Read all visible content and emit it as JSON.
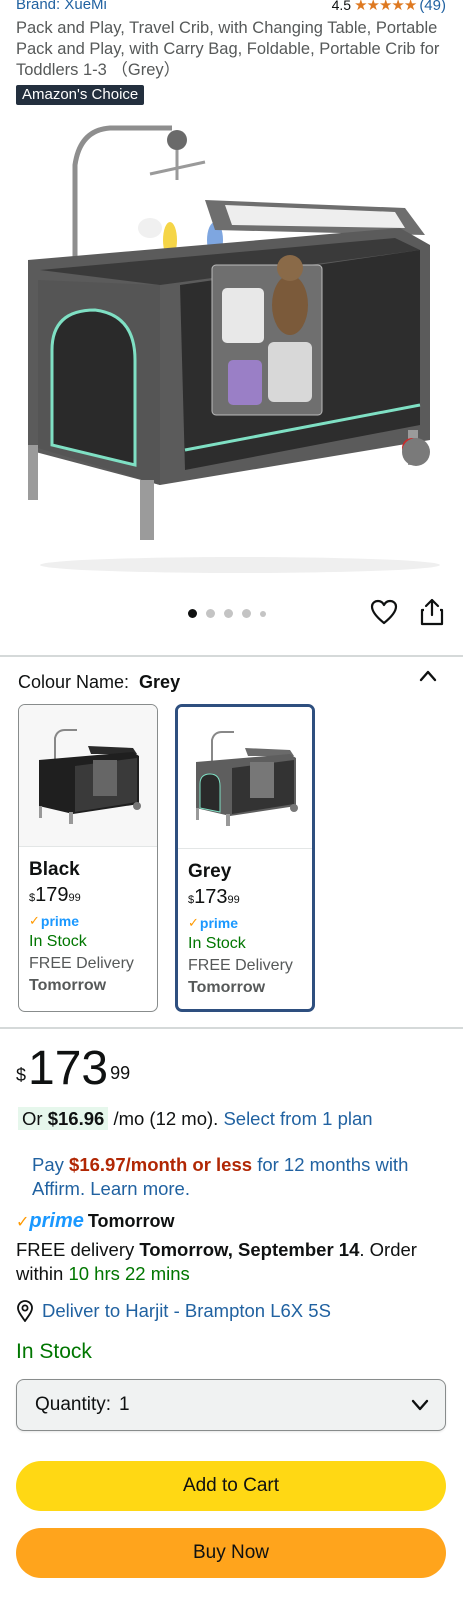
{
  "brand": "Brand: XueMi",
  "rating": {
    "value": "4.5",
    "stars": "★★★★★",
    "count": "(49)"
  },
  "title": "Pack and Play, Travel Crib, with Changing Table, Portable Pack and Play, with Carry Bag, Foldable, Portable Crib for Toddlers 1-3 （Grey）",
  "badge": "Amazon's Choice",
  "gallery": {
    "image_count": 5,
    "active_index": 0
  },
  "colour": {
    "label": "Colour Name:",
    "selected": "Grey",
    "options": [
      {
        "name": "Black",
        "currency": "$",
        "whole": "179",
        "cents": "99",
        "prime": "prime",
        "stock": "In Stock",
        "delivery": "FREE Delivery",
        "when": "Tomorrow"
      },
      {
        "name": "Grey",
        "currency": "$",
        "whole": "173",
        "cents": "99",
        "prime": "prime",
        "stock": "In Stock",
        "delivery": "FREE Delivery",
        "when": "Tomorrow"
      }
    ]
  },
  "price": {
    "currency": "$",
    "whole": "173",
    "cents": "99"
  },
  "monthly": {
    "or": "Or",
    "amount": "$16.96",
    "term": "/mo (12 mo).",
    "link": "Select from 1 plan"
  },
  "affirm": {
    "pay": "Pay",
    "amount": "$16.97/month or less",
    "rest": "for 12 months with Affirm. Learn more."
  },
  "prime_delivery": {
    "prime": "prime",
    "when": "Tomorrow"
  },
  "delivery": {
    "prefix": "FREE delivery",
    "date": "Tomorrow, September 14",
    "mid": ". Order within",
    "countdown": "10 hrs 22 mins"
  },
  "deliver_to": "Deliver to Harjit - Brampton L6X 5S",
  "stock": "In Stock",
  "quantity": {
    "label": "Quantity:",
    "value": "1"
  },
  "buttons": {
    "add_to_cart": "Add to Cart",
    "buy_now": "Buy Now"
  },
  "colors": {
    "link": "#2162a1",
    "in_stock": "#007600",
    "cart": "#ffd814",
    "buy": "#ffa41c",
    "price_red": "#b12704",
    "selected_border": "#2e4f7f"
  },
  "icons": [
    "heart-icon",
    "share-icon",
    "chevron-up-icon",
    "location-pin-icon",
    "chevron-down-icon",
    "prime-check-icon"
  ]
}
